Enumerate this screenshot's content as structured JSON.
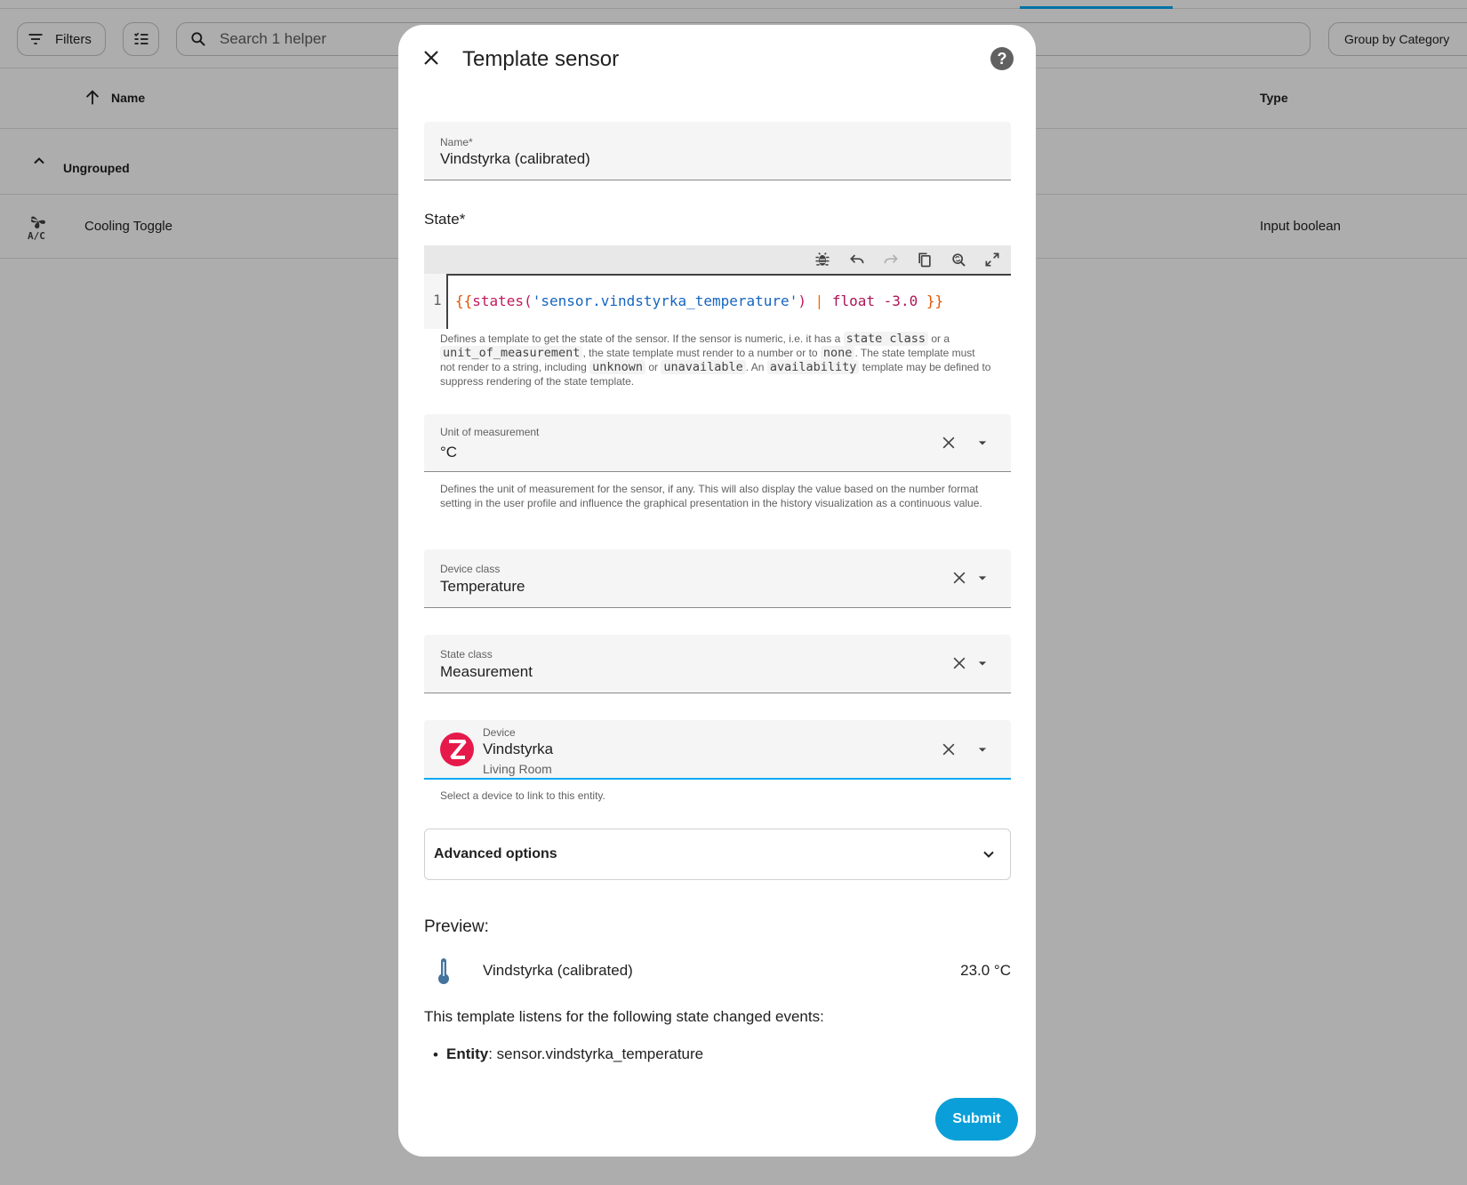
{
  "background": {
    "filters_label": "Filters",
    "search_placeholder": "Search 1 helper",
    "group_by_label": "Group by Category",
    "columns": {
      "name": "Name",
      "type": "Type"
    },
    "group_label": "Ungrouped",
    "rows": [
      {
        "icon": "air-conditioner-icon",
        "name": "Cooling Toggle",
        "type": "Input boolean"
      }
    ]
  },
  "dialog": {
    "title": "Template sensor",
    "name_field": {
      "label": "Name*",
      "value": "Vindstyrka (calibrated)"
    },
    "state": {
      "label": "State*",
      "line_number": "1",
      "code": {
        "open": "{{",
        "fn": "states(",
        "arg": "'sensor.vindstyrka_temperature'",
        "close_paren": ")",
        "pipe": " | ",
        "filter": "float -3.0",
        "close": " }}"
      },
      "helper": {
        "p1": "Defines a template to get the state of the sensor. If the sensor is numeric, i.e. it has a",
        "c1": "state class",
        "p2": "or a",
        "c2": "unit_of_measurement",
        "p3": ", the state template must render to a number or to",
        "c3": "none",
        "p4": ". The state template must not render to a string, including",
        "c4": "unknown",
        "p5": "or",
        "c5": "unavailable",
        "p6": ". An",
        "c6": "availability",
        "p7": "template may be defined to suppress rendering of the state template."
      }
    },
    "unit_field": {
      "label": "Unit of measurement",
      "value": "°C",
      "helper": "Defines the unit of measurement for the sensor, if any. This will also display the value based on the number format setting in the user profile and influence the graphical presentation in the history visualization as a continuous value."
    },
    "device_class_field": {
      "label": "Device class",
      "value": "Temperature"
    },
    "state_class_field": {
      "label": "State class",
      "value": "Measurement"
    },
    "device_field": {
      "label": "Device",
      "value": "Vindstyrka",
      "area": "Living Room",
      "helper": "Select a device to link to this entity."
    },
    "advanced_options": "Advanced options",
    "preview": {
      "title": "Preview:",
      "entity_name": "Vindstyrka (calibrated)",
      "entity_state": "23.0 °C",
      "listens_text": "This template listens for the following state changed events:",
      "entity_label": "Entity",
      "entity_id": ": sensor.vindstyrka_temperature"
    },
    "submit_label": "Submit"
  },
  "colors": {
    "accent": "#03a9f4",
    "submit": "#0a9fd8",
    "zigbee": "#e6194b",
    "thermometer": "#44739e"
  }
}
